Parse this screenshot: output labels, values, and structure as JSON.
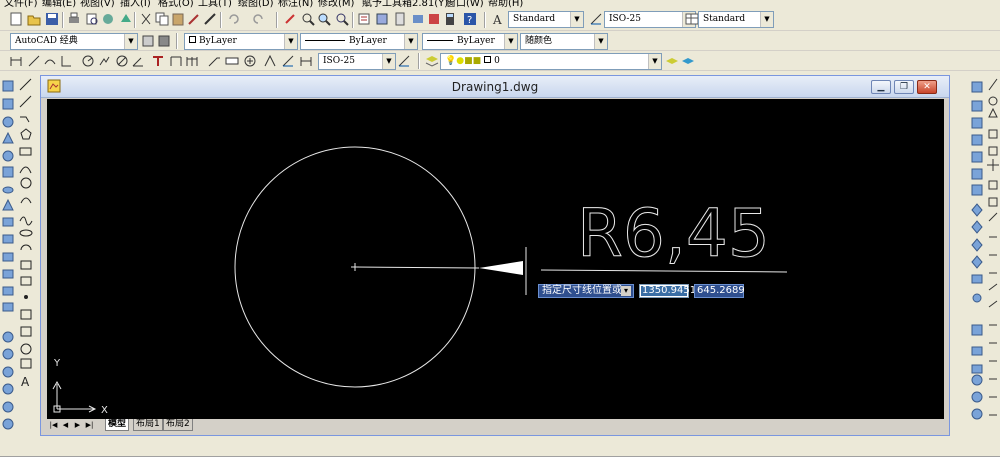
{
  "menu": [
    "文件(F)",
    "编辑(E)",
    "视图(V)",
    "插入(I)",
    "格式(O)",
    "工具(T)",
    "绘图(D)",
    "标注(N)",
    "修改(M)",
    "賦予工具箱2.81(Y)",
    "窗口(W)",
    "帮助(H)"
  ],
  "toolbar1": {
    "text_style": "Standard",
    "dim_style": "ISO-25",
    "table_style": "Standard"
  },
  "toolbar2": {
    "workspace": "AutoCAD 经典",
    "color": "ByLayer",
    "linetype": "ByLayer",
    "lineweight": "ByLayer",
    "plot_style": "随颜色"
  },
  "toolbar3": {
    "dim_style": "ISO-25",
    "layer": "0"
  },
  "window": {
    "title": "Drawing1.dwg"
  },
  "drawing": {
    "dimension_text": "R6,45",
    "ucs_x": "X",
    "ucs_y": "Y"
  },
  "dynamic_input": {
    "prompt": "指定尺寸线位置或",
    "x_value": "1350.9451",
    "y_value": "645.2689"
  },
  "layout_tabs": [
    "模型",
    "布局1",
    "布局2"
  ],
  "colors": {
    "canvas": "#000000",
    "highlight": "#3a6ea5",
    "title_gradient": "#c9d7ee"
  }
}
